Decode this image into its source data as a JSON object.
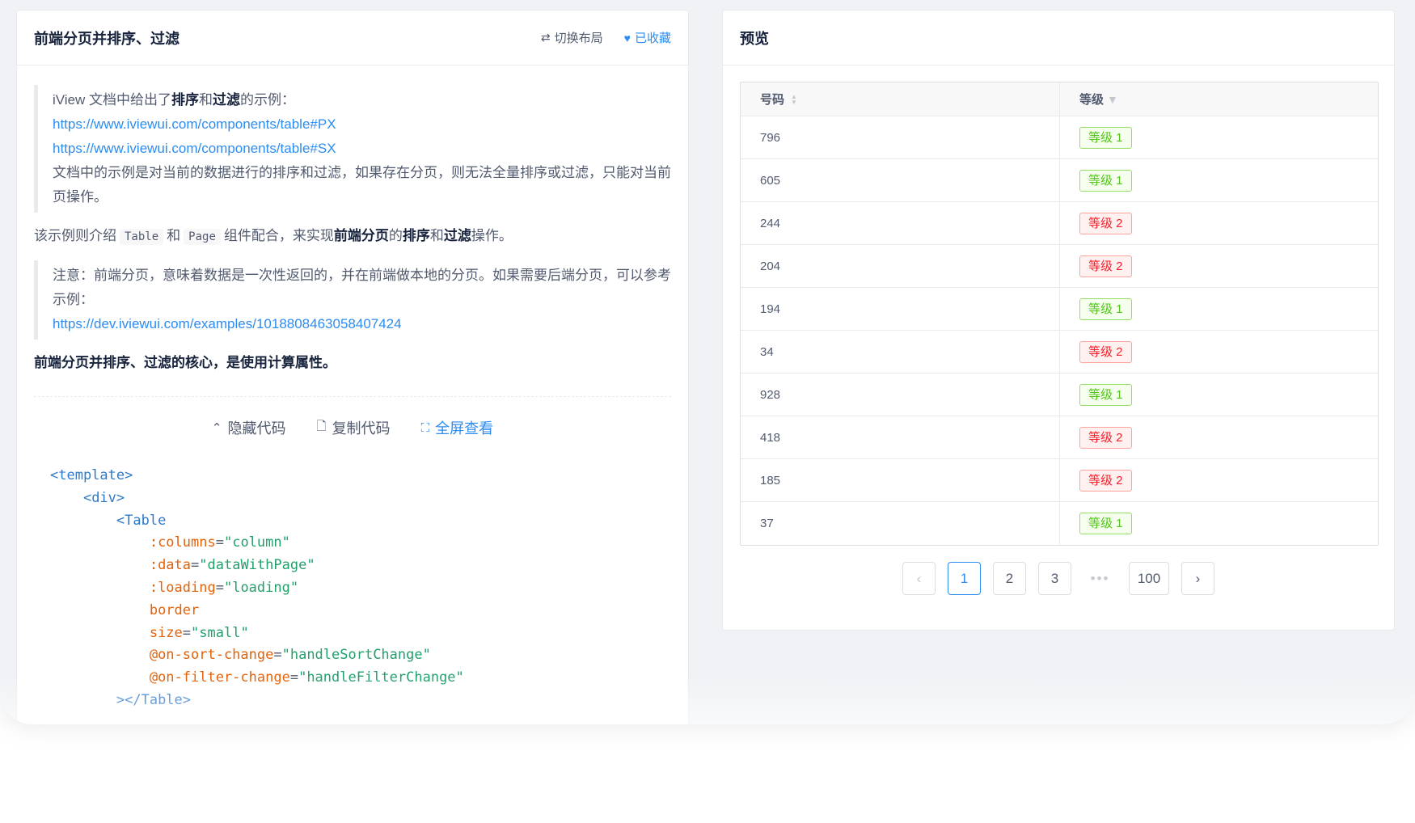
{
  "left": {
    "title": "前端分页并排序、过滤",
    "switch_layout": "切换布局",
    "favorited": "已收藏",
    "quote1_pre": "iView 文档中给出了",
    "quote1_b1": "排序",
    "quote1_mid": "和",
    "quote1_b2": "过滤",
    "quote1_post": "的示例：",
    "link_px": "https://www.iviewui.com/components/table#PX",
    "link_sx": "https://www.iviewui.com/components/table#SX",
    "quote1_desc": "文档中的示例是对当前的数据进行的排序和过滤，如果存在分页，则无法全量排序或过滤，只能对当前页操作。",
    "intro_pre": "该示例则介绍",
    "intro_code1": "Table",
    "intro_and": "和",
    "intro_code2": "Page",
    "intro_mid": "组件配合，来实现",
    "intro_b1": "前端分页",
    "intro_de": "的",
    "intro_b2": "排序",
    "intro_he": "和",
    "intro_b3": "过滤",
    "intro_post": "操作。",
    "note": "注意：前端分页，意味着数据是一次性返回的，并在前端做本地的分页。如果需要后端分页，可以参考示例：",
    "link_example": "https://dev.iviewui.com/examples/1018808463058407424",
    "summary": "前端分页并排序、过滤的核心，是使用计算属性。",
    "hide_code": "隐藏代码",
    "copy_code": "复制代码",
    "fullscreen": "全屏查看",
    "code": {
      "l1": "<template>",
      "l2": "<div>",
      "l3": "<Table",
      "l4_attr": ":columns",
      "l4_val": "\"column\"",
      "l5_attr": ":data",
      "l5_val": "\"dataWithPage\"",
      "l6_attr": ":loading",
      "l6_val": "\"loading\"",
      "l7_attr": "border",
      "l8_attr": "size",
      "l8_val": "\"small\"",
      "l9_attr": "@on-sort-change",
      "l9_val": "\"handleSortChange\"",
      "l10_attr": "@on-filter-change",
      "l10_val": "\"handleFilterChange\"",
      "l11": "></Table>"
    }
  },
  "right": {
    "title": "预览",
    "col_number": "号码",
    "col_level": "等级",
    "rows": [
      {
        "number": "796",
        "level": "等级 1",
        "color": "green"
      },
      {
        "number": "605",
        "level": "等级 1",
        "color": "green"
      },
      {
        "number": "244",
        "level": "等级 2",
        "color": "red"
      },
      {
        "number": "204",
        "level": "等级 2",
        "color": "red"
      },
      {
        "number": "194",
        "level": "等级 1",
        "color": "green"
      },
      {
        "number": "34",
        "level": "等级 2",
        "color": "red"
      },
      {
        "number": "928",
        "level": "等级 1",
        "color": "green"
      },
      {
        "number": "418",
        "level": "等级 2",
        "color": "red"
      },
      {
        "number": "185",
        "level": "等级 2",
        "color": "red"
      },
      {
        "number": "37",
        "level": "等级 1",
        "color": "green"
      }
    ],
    "pager": {
      "prev": "‹",
      "p1": "1",
      "p2": "2",
      "p3": "3",
      "ellipsis": "•••",
      "last": "100",
      "next": "›"
    }
  },
  "colors": {
    "accent": "#2d8cf0",
    "tag_green": "#52c41a",
    "tag_red": "#f5222d"
  }
}
